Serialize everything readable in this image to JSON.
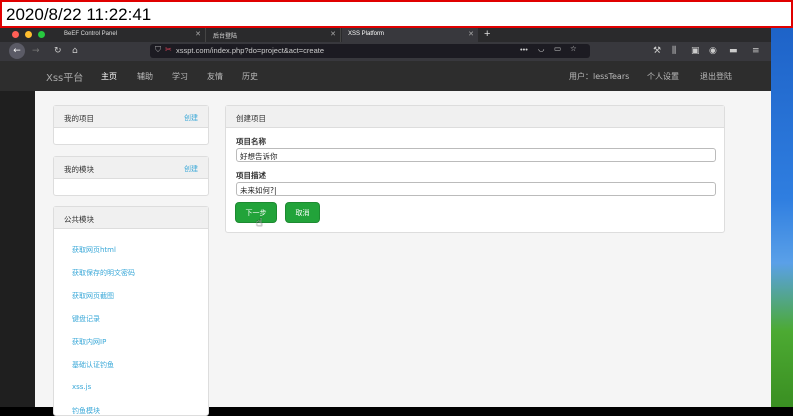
{
  "timestamp": "2020/8/22 11:22:41",
  "browser": {
    "tabs": [
      {
        "label": "BeEF Control Panel"
      },
      {
        "label": "后台登陆"
      },
      {
        "label": "XSS Platform"
      }
    ],
    "new_tab": "+",
    "url": "xsspt.com/index.php?do=project&act=create"
  },
  "site": {
    "logo": "Xss平台",
    "nav": [
      "主页",
      "辅助",
      "学习",
      "友情",
      "历史"
    ],
    "user_label": "用户：lessTears",
    "settings": "个人设置",
    "logout": "退出登陆"
  },
  "sidebar": {
    "my_projects": {
      "title": "我的项目",
      "action": "创建"
    },
    "my_modules": {
      "title": "我的模块",
      "action": "创建"
    },
    "public_modules": {
      "title": "公共模块",
      "items": [
        "获取网页html",
        "获取保存的明文密码",
        "获取网页截图",
        "键盘记录",
        "获取内网IP",
        "基础认证钓鱼",
        "xss.js",
        "钓鱼模块"
      ]
    }
  },
  "form": {
    "title": "创建项目",
    "name_label": "项目名称",
    "name_value": "好想告诉你",
    "desc_label": "项目描述",
    "desc_value": "未来如何?|",
    "next_button": "下一步",
    "cancel_button": "取消"
  },
  "colors": {
    "accent": "#22a33a",
    "link": "#3aa8d8",
    "stamp_border": "#e00000"
  }
}
